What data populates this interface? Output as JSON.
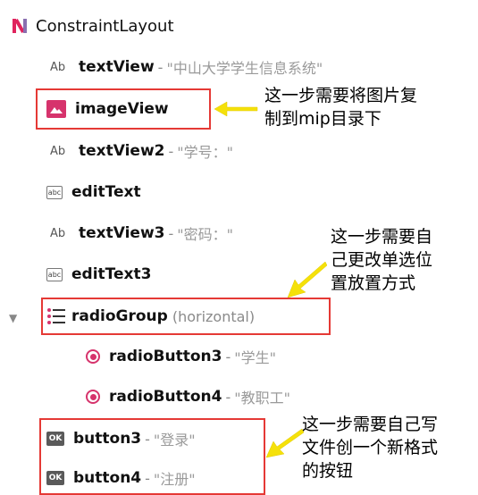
{
  "tree": {
    "root": {
      "label": "ConstraintLayout",
      "icon": "constraint-layout-icon"
    },
    "items": [
      {
        "icon_text": "Ab",
        "name": "textView",
        "sep": "-",
        "value": "\"中山大学学生信息系统\""
      },
      {
        "icon": "image-icon",
        "name": "imageView"
      },
      {
        "icon_text": "Ab",
        "name": "textView2",
        "sep": "-",
        "value": "\"学号：\""
      },
      {
        "icon_text": "abc",
        "name": "editText"
      },
      {
        "icon_text": "Ab",
        "name": "textView3",
        "sep": "-",
        "value": "\"密码：\""
      },
      {
        "icon_text": "abc",
        "name": "editText3"
      },
      {
        "icon": "list-icon",
        "name": "radioGroup",
        "extra": "(horizontal)",
        "expander": "▼"
      },
      {
        "icon": "radio-button-icon",
        "name": "radioButton3",
        "sep": "-",
        "value": "\"学生\""
      },
      {
        "icon": "radio-button-icon",
        "name": "radioButton4",
        "sep": "-",
        "value": "\"教职工\""
      },
      {
        "icon_text": "OK",
        "name": "button3",
        "sep": "-",
        "value": "\"登录\""
      },
      {
        "icon_text": "OK",
        "name": "button4",
        "sep": "-",
        "value": "\"注册\""
      }
    ]
  },
  "annotations": {
    "image_note": [
      "这一步需要将图片复",
      "制到mip目录下"
    ],
    "radio_note": [
      "这一步需要自",
      "己更改单选位",
      "置放置方式"
    ],
    "button_note": [
      "这一步需要自己写",
      "文件创一个新格式",
      "的按钮"
    ]
  },
  "colors": {
    "highlight_box": "#e53935",
    "arrow": "#f5e10a",
    "accent_icon": "#d6336c"
  }
}
